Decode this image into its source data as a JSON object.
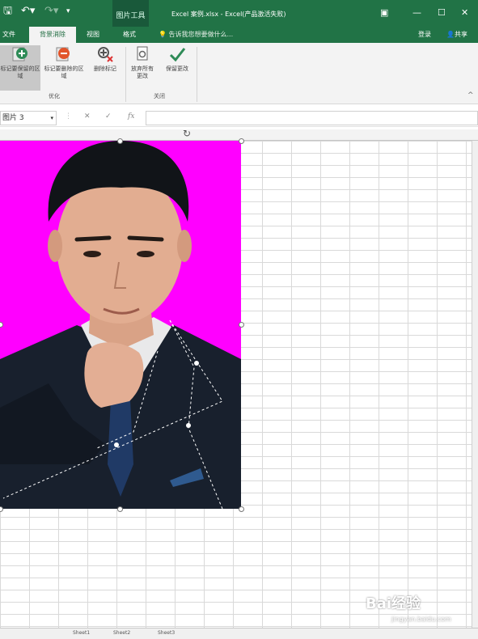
{
  "window": {
    "title": "Excel 案例.xlsx - Excel(产品激活失败)",
    "context_tab": "图片工具",
    "restore_icon": "ribbon-display-icon"
  },
  "menu": {
    "tabs": [
      {
        "label": "文件"
      },
      {
        "label": "背景消除"
      },
      {
        "label": "视图"
      },
      {
        "label": "格式"
      }
    ],
    "tell_me": "告诉我您想要做什么...",
    "login": "登录",
    "share": "共享"
  },
  "ribbon": {
    "buttons": [
      {
        "label": "标记要保留的区域",
        "icon": "plus-circle-icon"
      },
      {
        "label": "标记要删除的区域",
        "icon": "minus-circle-icon"
      },
      {
        "label": "删除标记",
        "icon": "delete-mark-icon"
      },
      {
        "label": "放弃所有更改",
        "icon": "discard-icon"
      },
      {
        "label": "保留更改",
        "icon": "checkmark-icon"
      }
    ],
    "groups": [
      {
        "label": "优化"
      },
      {
        "label": "关闭"
      }
    ]
  },
  "formula_bar": {
    "name_box": "图片 3",
    "cancel": "✕",
    "enter": "✓",
    "fx": "fx",
    "value": ""
  },
  "sheets": {
    "tabs": [
      "Sheet1",
      "Sheet2",
      "Sheet3"
    ]
  },
  "colors": {
    "excel_green": "#217346",
    "removal_magenta": "#ff00ff"
  },
  "watermark": {
    "brand": "Bai经验",
    "url": "jingyan.baidu.com"
  }
}
